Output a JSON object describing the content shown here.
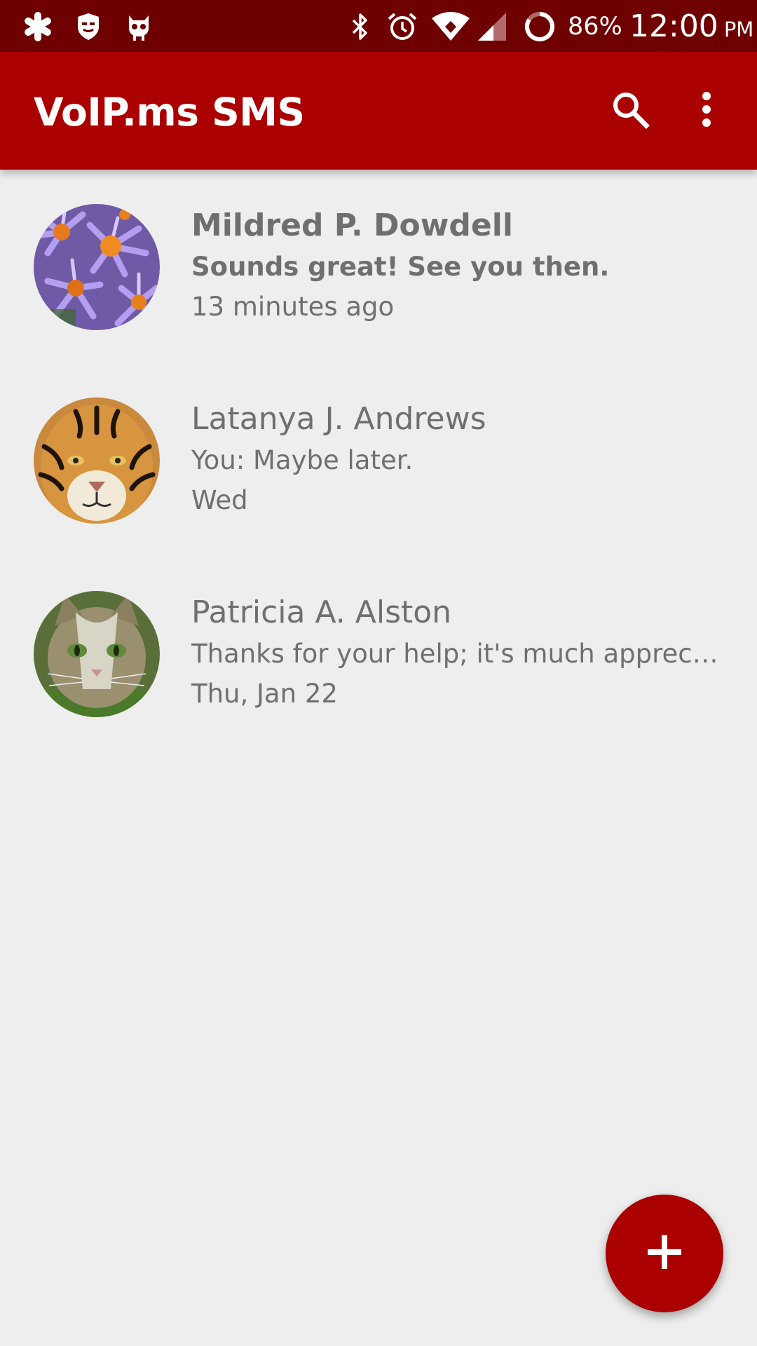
{
  "status_bar": {
    "battery": "86%",
    "time": "12:00",
    "ampm": "PM",
    "left_icons": [
      "asterisk-notification-icon",
      "shield-notification-icon",
      "android-notification-icon"
    ],
    "right_icons": [
      "bluetooth-icon",
      "alarm-icon",
      "wifi-icon",
      "cell-signal-icon",
      "battery-icon"
    ]
  },
  "app_bar": {
    "title": "VoIP.ms SMS",
    "background": "#aa0000",
    "actions": [
      "search-icon",
      "more-vert-icon"
    ]
  },
  "conversations": [
    {
      "name": "Mildred P. Dowdell",
      "snippet": "Sounds great! See you then.",
      "date": "13 minutes ago",
      "unread": true,
      "avatar": "purple-daisies-photo"
    },
    {
      "name": "Latanya J. Andrews",
      "snippet": "You: Maybe later.",
      "date": "Wed",
      "unread": false,
      "avatar": "tiger-photo"
    },
    {
      "name": "Patricia A. Alston",
      "snippet": "Thanks for your help; it's much appreci…",
      "date": "Thu, Jan 22",
      "unread": false,
      "avatar": "cat-photo"
    }
  ],
  "fab": {
    "icon": "plus-icon",
    "color": "#aa0000"
  },
  "colors": {
    "status_bar": "#6f0000",
    "app_bar": "#aa0000",
    "background": "#eeeeee",
    "text": "#6f6f6f"
  }
}
